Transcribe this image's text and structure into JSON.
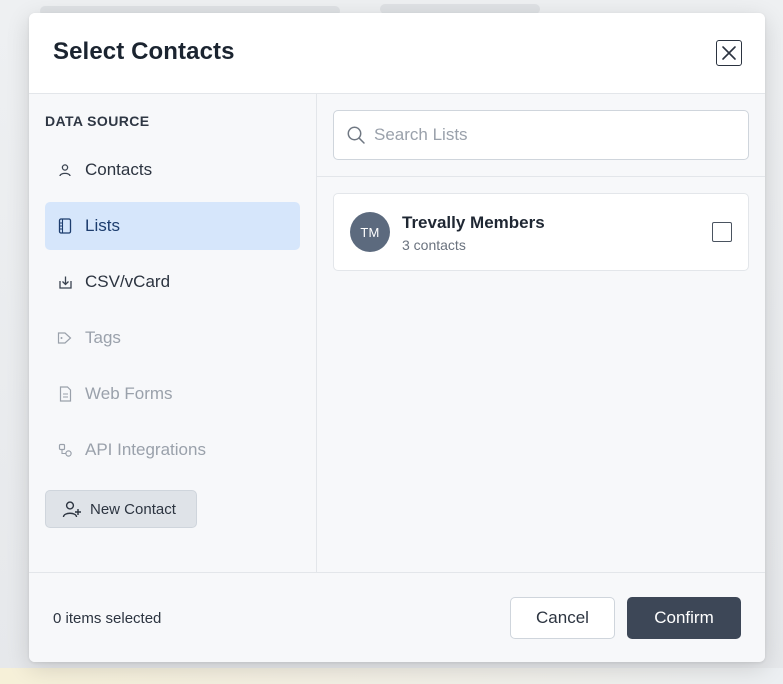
{
  "modal": {
    "title": "Select Contacts",
    "close_icon": "close-icon"
  },
  "sidebar": {
    "section_label": "DATA SOURCE",
    "items": [
      {
        "label": "Contacts",
        "icon": "person-icon",
        "state": "normal"
      },
      {
        "label": "Lists",
        "icon": "list-icon",
        "state": "active"
      },
      {
        "label": "CSV/vCard",
        "icon": "import-icon",
        "state": "normal"
      },
      {
        "label": "Tags",
        "icon": "tag-icon",
        "state": "disabled"
      },
      {
        "label": "Web Forms",
        "icon": "document-icon",
        "state": "disabled"
      },
      {
        "label": "API Integrations",
        "icon": "integration-icon",
        "state": "disabled"
      }
    ],
    "new_contact_label": "New Contact",
    "new_contact_icon": "add-user-icon"
  },
  "search": {
    "placeholder": "Search Lists",
    "value": ""
  },
  "lists": [
    {
      "initials": "TM",
      "name": "Trevally Members",
      "count": "3 contacts",
      "checked": false
    }
  ],
  "footer": {
    "selected_count": "0 items selected",
    "cancel_label": "Cancel",
    "confirm_label": "Confirm"
  },
  "colors": {
    "accent_active_bg": "#d6e6fb",
    "primary_button": "#3d4757",
    "avatar_bg": "#5c6a7e"
  }
}
